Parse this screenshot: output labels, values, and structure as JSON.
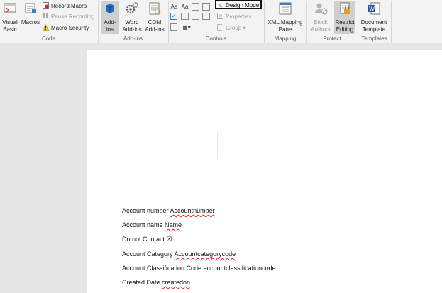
{
  "ribbon": {
    "code": {
      "group_label": "Code",
      "visual_basic": "Visual\nBasic",
      "macros": "Macros",
      "record_macro": "Record Macro",
      "pause_recording": "Pause Recording",
      "macro_security": "Macro Security"
    },
    "addins": {
      "group_label": "Add-ins",
      "addins": "Add-\nins",
      "word_addins": "Word\nAdd-ins",
      "com_addins": "COM\nAdd-ins"
    },
    "controls": {
      "group_label": "Controls",
      "design_mode": "Design Mode",
      "properties": "Properties",
      "group": "Group"
    },
    "mapping": {
      "group_label": "Mapping",
      "xml_mapping_pane": "XML Mapping\nPane"
    },
    "protect": {
      "group_label": "Protect",
      "block_authors": "Block\nAuthors",
      "restrict_editing": "Restrict\nEditing"
    },
    "templates": {
      "group_label": "Templates",
      "document_template": "Document\nTemplate"
    }
  },
  "document": {
    "lines": [
      {
        "label": "Account number ",
        "field": "Accountnumber"
      },
      {
        "label": "Account name ",
        "field": "Name"
      },
      {
        "label": "Do not Contact ",
        "field": "☒"
      },
      {
        "label": "Account Category ",
        "field": "Accountcategorycode"
      },
      {
        "label": "Account Classification Code ",
        "field": "accountclassificationcode"
      },
      {
        "label": "Created Date ",
        "field": "createdon"
      }
    ]
  },
  "colors": {
    "ribbon_bg": "#f3f3f3",
    "active_button": "#cfcfcf",
    "spell_squiggle": "#e0241b",
    "addins_icon": "#1f6fc4"
  }
}
